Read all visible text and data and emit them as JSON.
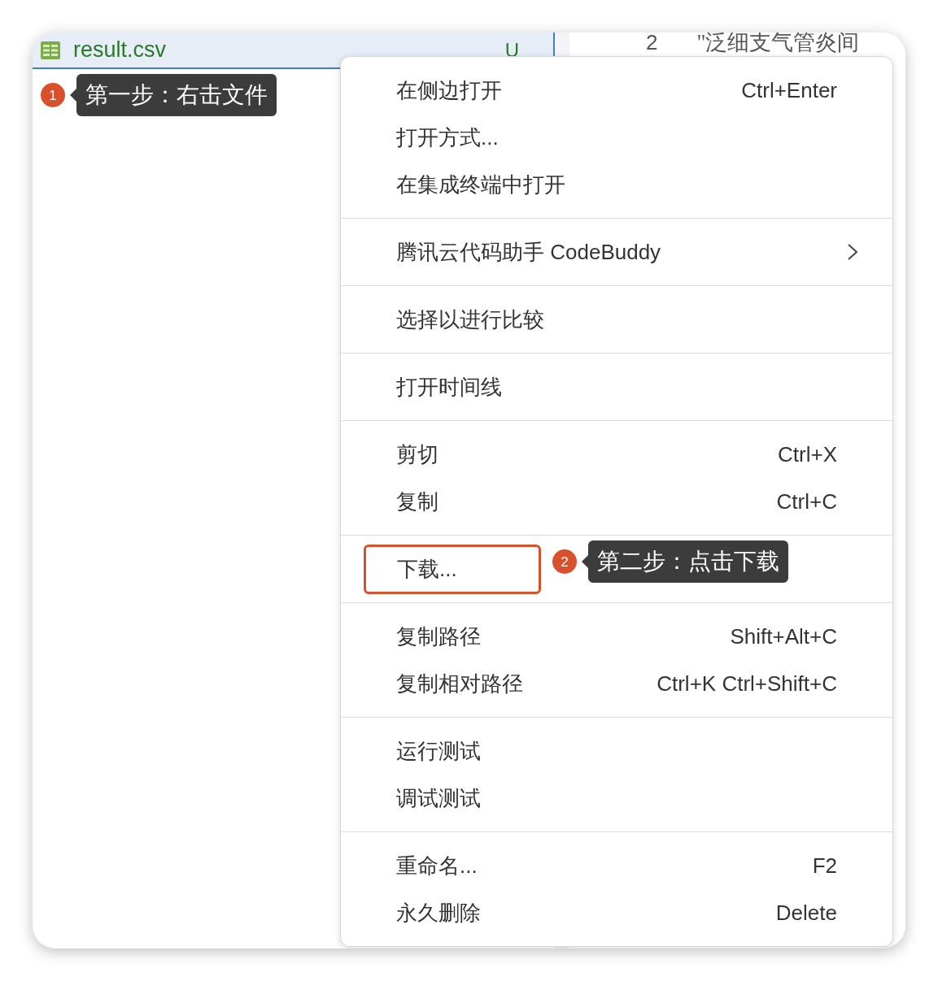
{
  "file_tab": {
    "name": "result.csv",
    "status": "U"
  },
  "editor": {
    "line_number": "2",
    "text": "\"泛细支气管炎间"
  },
  "annotations": [
    {
      "number": "1",
      "text": "第一步：右击文件"
    },
    {
      "number": "2",
      "text": "第二步：点击下载"
    }
  ],
  "context_menu": {
    "groups": [
      [
        {
          "label": "在侧边打开",
          "shortcut": "Ctrl+Enter",
          "has_submenu": false,
          "highlighted": false
        },
        {
          "label": "打开方式...",
          "has_submenu": false,
          "highlighted": false
        },
        {
          "label": "在集成终端中打开",
          "has_submenu": false,
          "highlighted": false
        }
      ],
      [
        {
          "label": "腾讯云代码助手 CodeBuddy",
          "has_submenu": true,
          "highlighted": false
        }
      ],
      [
        {
          "label": "选择以进行比较",
          "has_submenu": false,
          "highlighted": false
        }
      ],
      [
        {
          "label": "打开时间线",
          "has_submenu": false,
          "highlighted": false
        }
      ],
      [
        {
          "label": "剪切",
          "shortcut": "Ctrl+X",
          "has_submenu": false,
          "highlighted": false
        },
        {
          "label": "复制",
          "shortcut": "Ctrl+C",
          "has_submenu": false,
          "highlighted": false
        }
      ],
      [
        {
          "label": "下载...",
          "has_submenu": false,
          "highlighted": true
        }
      ],
      [
        {
          "label": "复制路径",
          "shortcut": "Shift+Alt+C",
          "has_submenu": false,
          "highlighted": false
        },
        {
          "label": "复制相对路径",
          "shortcut": "Ctrl+K Ctrl+Shift+C",
          "has_submenu": false,
          "highlighted": false
        }
      ],
      [
        {
          "label": "运行测试",
          "has_submenu": false,
          "highlighted": false
        },
        {
          "label": "调试测试",
          "has_submenu": false,
          "highlighted": false
        }
      ],
      [
        {
          "label": "重命名...",
          "shortcut": "F2",
          "has_submenu": false,
          "highlighted": false
        },
        {
          "label": "永久删除",
          "shortcut": "Delete",
          "has_submenu": false,
          "highlighted": false
        }
      ]
    ]
  }
}
